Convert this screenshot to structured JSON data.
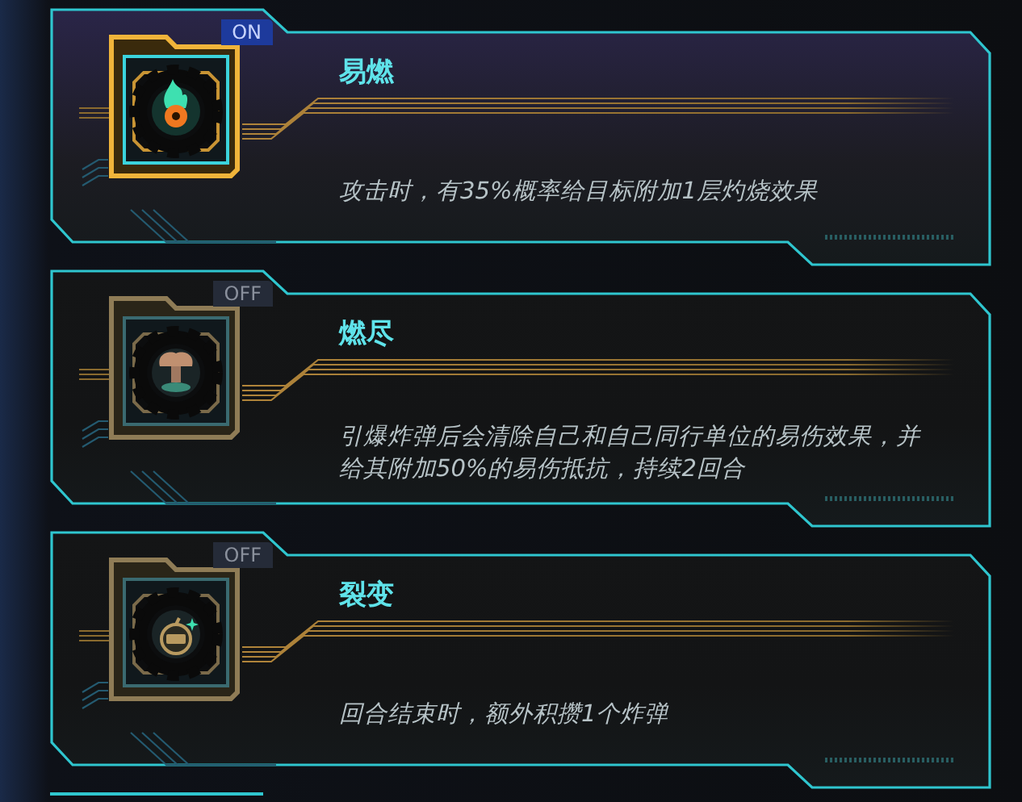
{
  "cards": [
    {
      "kind": "flame",
      "on": true,
      "badge": "ON",
      "title": "易燃",
      "description": "攻击时，有35%概率给目标附加1层灼烧效果"
    },
    {
      "kind": "cloud",
      "on": false,
      "badge": "OFF",
      "title": "燃尽",
      "description": "引爆炸弹后会清除自己和自己同行单位的易伤效果，并给其附加50%的易伤抵抗，持续2回合"
    },
    {
      "kind": "bomb",
      "on": false,
      "badge": "OFF",
      "title": "裂变",
      "description": "回合结束时，额外积攒1个炸弹"
    }
  ]
}
